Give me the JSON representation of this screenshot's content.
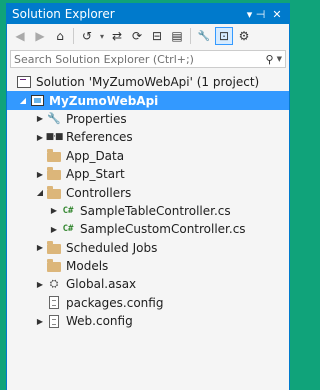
{
  "window": {
    "title": "Solution Explorer",
    "pin_glyph": "▾ ⊣",
    "close_glyph": "✕"
  },
  "toolbar": {
    "back_glyph": "◀",
    "forward_glyph": "▶",
    "home_glyph": "⌂",
    "history_glyph": "↺",
    "dropdown_glyph": "▾",
    "sync_glyph": "⇄",
    "refresh_glyph": "⟳",
    "collapse_glyph": "⊟",
    "show_files_glyph": "▤",
    "properties_glyph": "🔧",
    "preview_glyph": "⊡",
    "view_glyph": "⚙"
  },
  "search": {
    "placeholder": "Search Solution Explorer (Ctrl+;)",
    "icon_glyph": "⚲",
    "dropdown_glyph": "▼"
  },
  "tree": {
    "solution": {
      "label": "Solution 'MyZumoWebApi' (1 project)"
    },
    "project": {
      "label": "MyZumoWebApi",
      "expanded": true,
      "selected": true
    },
    "items": [
      {
        "label": "Properties",
        "icon": "wrench-icon",
        "arrow": "▶"
      },
      {
        "label": "References",
        "icon": "references-icon",
        "arrow": "▶"
      },
      {
        "label": "App_Data",
        "icon": "folder-icon",
        "arrow": ""
      },
      {
        "label": "App_Start",
        "icon": "folder-icon",
        "arrow": "▶"
      },
      {
        "label": "Controllers",
        "icon": "folder-icon",
        "arrow": "◢",
        "expanded": true
      },
      {
        "label": "SampleTableController.cs",
        "icon": "csharp-file-icon",
        "arrow": "▶",
        "child": true
      },
      {
        "label": "SampleCustomController.cs",
        "icon": "csharp-file-icon",
        "arrow": "▶",
        "child": true
      },
      {
        "label": "Scheduled Jobs",
        "icon": "folder-icon",
        "arrow": "▶"
      },
      {
        "label": "Models",
        "icon": "folder-icon",
        "arrow": ""
      },
      {
        "label": "Global.asax",
        "icon": "global-asax-icon",
        "arrow": "▶"
      },
      {
        "label": "packages.config",
        "icon": "config-file-icon",
        "arrow": ""
      },
      {
        "label": "Web.config",
        "icon": "web-config-icon",
        "arrow": "▶"
      }
    ],
    "project_arrow": "◢",
    "cs_glyph": "C#",
    "ref_glyph": "■·■"
  },
  "colors": {
    "accent": "#007acc",
    "selection": "#3399ff",
    "background": "#10a37a",
    "folder": "#dcb67a"
  }
}
